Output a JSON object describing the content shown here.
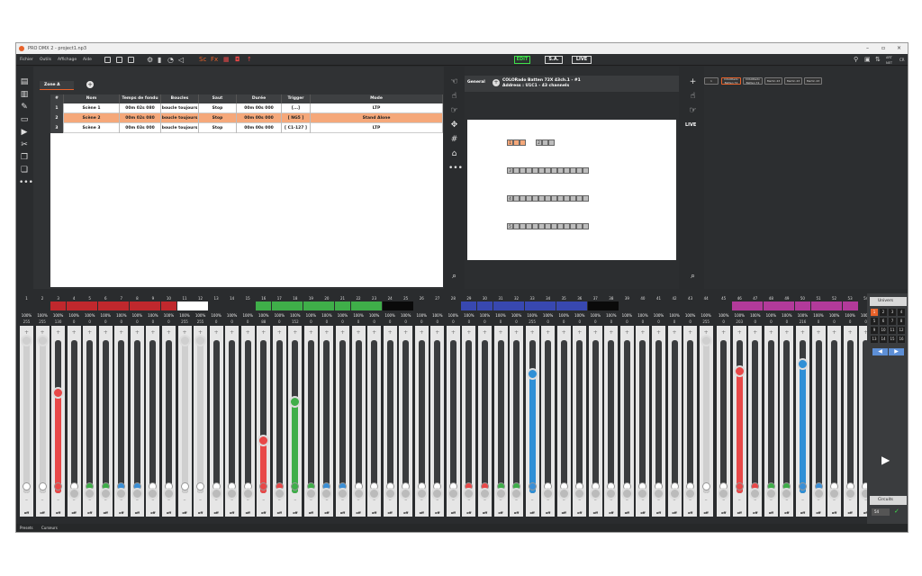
{
  "window": {
    "title": "PRO DMX 2 - project1.np3",
    "controls": [
      "–",
      "▫",
      "×"
    ]
  },
  "menu": {
    "items": [
      "Fichier",
      "Outils",
      "Affichage",
      "Aide"
    ],
    "modes": [
      "EDIT",
      "S.A.",
      "LIVE"
    ],
    "right_labels": [
      "ART NET",
      "CR"
    ]
  },
  "scenes": {
    "tab_label": "Zone A",
    "headers": [
      "#",
      "Nom",
      "Temps de fondu",
      "Boucles",
      "Saut",
      "Durée",
      "Trigger",
      "Mode"
    ],
    "rows": [
      {
        "num": "1",
        "name": "Scène 1",
        "fade": "00m 02s 080",
        "loop": "boucle toujours",
        "jump": "Stop",
        "duration": "00m 00s 000",
        "trigger": "[...]",
        "mode": "LTP",
        "selected": false
      },
      {
        "num": "2",
        "name": "Scène 2",
        "fade": "00m 02s 080",
        "loop": "boucle toujours",
        "jump": "Stop",
        "duration": "00m 00s 000",
        "trigger": "[ NG5 ]",
        "mode": "Stand Alone",
        "selected": true
      },
      {
        "num": "3",
        "name": "Scène 3",
        "fade": "00m 03s 000",
        "loop": "boucle toujours",
        "jump": "Stop",
        "duration": "00m 00s 000",
        "trigger": "[ C1-127 ]",
        "mode": "LTP",
        "selected": false
      }
    ]
  },
  "fixture": {
    "tab_label": "General",
    "name": "COLORado Batten 72X 43ch.1 - #1",
    "address": "Address : U1C1 - 43 channels",
    "group_labels": [
      "1",
      "2",
      "3",
      "4",
      "5"
    ]
  },
  "presets": {
    "chips": [
      "1",
      "COLORado Batten 72",
      "COLORado Batten 72",
      "Martin 43",
      "Martin 43",
      "Martin 43"
    ],
    "live_label": "LIVE"
  },
  "faders": {
    "channels": [
      {
        "n": "1",
        "color": "#2a2c2e",
        "val": "255",
        "level": 1.0,
        "fill": "#cfcfcf",
        "ball": "#ffffff"
      },
      {
        "n": "2",
        "color": "#2a2c2e",
        "val": "255",
        "level": 1.0,
        "fill": "#cfcfcf",
        "ball": "#ffffff"
      },
      {
        "n": "3",
        "color": "#c0282d",
        "val": "130",
        "level": 0.66,
        "fill": "#e84848",
        "ball": "#e84848"
      },
      {
        "n": "4",
        "color": "#c0282d",
        "val": "0",
        "level": 0,
        "fill": "",
        "ball": "#ffffff"
      },
      {
        "n": "5",
        "color": "#c0282d",
        "val": "0",
        "level": 0,
        "fill": "",
        "ball": "#3fae49"
      },
      {
        "n": "6",
        "color": "#c0282d",
        "val": "0",
        "level": 0,
        "fill": "",
        "ball": "#3fae49"
      },
      {
        "n": "7",
        "color": "#c0282d",
        "val": "0",
        "level": 0,
        "fill": "",
        "ball": "#3b8fd6"
      },
      {
        "n": "8",
        "color": "#c0282d",
        "val": "0",
        "level": 0,
        "fill": "",
        "ball": "#3b8fd6"
      },
      {
        "n": "9",
        "color": "#c0282d",
        "val": "0",
        "level": 0,
        "fill": "",
        "ball": "#ffffff"
      },
      {
        "n": "10",
        "color": "#c0282d",
        "val": "0",
        "level": 0,
        "fill": "",
        "ball": "#ffffff"
      },
      {
        "n": "11",
        "color": "#ffffff",
        "val": "255",
        "level": 1.0,
        "fill": "#cfcfcf",
        "ball": "#ffffff"
      },
      {
        "n": "12",
        "color": "#ffffff",
        "val": "255",
        "level": 1.0,
        "fill": "#cfcfcf",
        "ball": "#ffffff"
      },
      {
        "n": "13",
        "color": "#2a2c2e",
        "val": "0",
        "level": 0,
        "fill": "",
        "ball": "#ffffff"
      },
      {
        "n": "14",
        "color": "#2a2c2e",
        "val": "0",
        "level": 0,
        "fill": "",
        "ball": "#ffffff"
      },
      {
        "n": "15",
        "color": "#2a2c2e",
        "val": "0",
        "level": 0,
        "fill": "",
        "ball": "#ffffff"
      },
      {
        "n": "16",
        "color": "#3fae49",
        "val": "88",
        "level": 0.35,
        "fill": "#e84848",
        "ball": "#e84848"
      },
      {
        "n": "17",
        "color": "#3fae49",
        "val": "0",
        "level": 0,
        "fill": "",
        "ball": "#e84848"
      },
      {
        "n": "18",
        "color": "#3fae49",
        "val": "152",
        "level": 0.6,
        "fill": "#3fae49",
        "ball": "#3fae49"
      },
      {
        "n": "19",
        "color": "#3fae49",
        "val": "0",
        "level": 0,
        "fill": "",
        "ball": "#3fae49"
      },
      {
        "n": "20",
        "color": "#3fae49",
        "val": "0",
        "level": 0,
        "fill": "",
        "ball": "#3b8fd6"
      },
      {
        "n": "21",
        "color": "#3fae49",
        "val": "0",
        "level": 0,
        "fill": "",
        "ball": "#3b8fd6"
      },
      {
        "n": "22",
        "color": "#3fae49",
        "val": "0",
        "level": 0,
        "fill": "",
        "ball": "#ffffff"
      },
      {
        "n": "23",
        "color": "#3fae49",
        "val": "0",
        "level": 0,
        "fill": "",
        "ball": "#ffffff"
      },
      {
        "n": "24",
        "color": "#0a0a0a",
        "val": "0",
        "level": 0,
        "fill": "",
        "ball": "#ffffff"
      },
      {
        "n": "25",
        "color": "#0a0a0a",
        "val": "0",
        "level": 0,
        "fill": "",
        "ball": "#ffffff"
      },
      {
        "n": "26",
        "color": "#2a2c2e",
        "val": "0",
        "level": 0,
        "fill": "",
        "ball": "#ffffff"
      },
      {
        "n": "27",
        "color": "#2a2c2e",
        "val": "0",
        "level": 0,
        "fill": "",
        "ball": "#ffffff"
      },
      {
        "n": "28",
        "color": "#2a2c2e",
        "val": "0",
        "level": 0,
        "fill": "",
        "ball": "#ffffff"
      },
      {
        "n": "29",
        "color": "#3848b0",
        "val": "0",
        "level": 0,
        "fill": "",
        "ball": "#e84848"
      },
      {
        "n": "30",
        "color": "#3848b0",
        "val": "0",
        "level": 0,
        "fill": "",
        "ball": "#e84848"
      },
      {
        "n": "31",
        "color": "#3848b0",
        "val": "0",
        "level": 0,
        "fill": "",
        "ball": "#3fae49"
      },
      {
        "n": "32",
        "color": "#3848b0",
        "val": "0",
        "level": 0,
        "fill": "",
        "ball": "#3fae49"
      },
      {
        "n": "33",
        "color": "#3848b0",
        "val": "255",
        "level": 0.78,
        "fill": "#2f8fd6",
        "ball": "#3b8fd6"
      },
      {
        "n": "34",
        "color": "#3848b0",
        "val": "0",
        "level": 0,
        "fill": "",
        "ball": "#ffffff"
      },
      {
        "n": "35",
        "color": "#3848b0",
        "val": "0",
        "level": 0,
        "fill": "",
        "ball": "#ffffff"
      },
      {
        "n": "36",
        "color": "#3848b0",
        "val": "0",
        "level": 0,
        "fill": "",
        "ball": "#ffffff"
      },
      {
        "n": "37",
        "color": "#0a0a0a",
        "val": "0",
        "level": 0,
        "fill": "",
        "ball": "#ffffff"
      },
      {
        "n": "38",
        "color": "#0a0a0a",
        "val": "0",
        "level": 0,
        "fill": "",
        "ball": "#ffffff"
      },
      {
        "n": "39",
        "color": "#2a2c2e",
        "val": "0",
        "level": 0,
        "fill": "",
        "ball": "#ffffff"
      },
      {
        "n": "40",
        "color": "#2a2c2e",
        "val": "0",
        "level": 0,
        "fill": "",
        "ball": "#ffffff"
      },
      {
        "n": "41",
        "color": "#2a2c2e",
        "val": "0",
        "level": 0,
        "fill": "",
        "ball": "#ffffff"
      },
      {
        "n": "42",
        "color": "#2a2c2e",
        "val": "0",
        "level": 0,
        "fill": "",
        "ball": "#ffffff"
      },
      {
        "n": "43",
        "color": "#2a2c2e",
        "val": "0",
        "level": 0,
        "fill": "",
        "ball": "#ffffff"
      },
      {
        "n": "44",
        "color": "#2a2c2e",
        "val": "255",
        "level": 1.0,
        "fill": "#cfcfcf",
        "ball": "#ffffff"
      },
      {
        "n": "45",
        "color": "#2a2c2e",
        "val": "0",
        "level": 0,
        "fill": "",
        "ball": "#ffffff"
      },
      {
        "n": "46",
        "color": "#b23a9a",
        "val": "203",
        "level": 0.8,
        "fill": "#e84848",
        "ball": "#e84848"
      },
      {
        "n": "47",
        "color": "#b23a9a",
        "val": "0",
        "level": 0,
        "fill": "",
        "ball": "#e84848"
      },
      {
        "n": "48",
        "color": "#b23a9a",
        "val": "0",
        "level": 0,
        "fill": "",
        "ball": "#3fae49"
      },
      {
        "n": "49",
        "color": "#b23a9a",
        "val": "0",
        "level": 0,
        "fill": "",
        "ball": "#3fae49"
      },
      {
        "n": "50",
        "color": "#b23a9a",
        "val": "216",
        "level": 0.85,
        "fill": "#2f8fd6",
        "ball": "#3b8fd6"
      },
      {
        "n": "51",
        "color": "#b23a9a",
        "val": "0",
        "level": 0,
        "fill": "",
        "ball": "#3b8fd6"
      },
      {
        "n": "52",
        "color": "#b23a9a",
        "val": "0",
        "level": 0,
        "fill": "",
        "ball": "#ffffff"
      },
      {
        "n": "53",
        "color": "#b23a9a",
        "val": "0",
        "level": 0,
        "fill": "",
        "ball": "#ffffff"
      },
      {
        "n": "54",
        "color": "#2a2c2e",
        "val": "0",
        "level": 0,
        "fill": "",
        "ball": "#ffffff"
      }
    ],
    "percent": "100%",
    "off": "off"
  },
  "right_panel": {
    "title": "Univers",
    "numbers": [
      "1",
      "2",
      "3",
      "4",
      "5",
      "6",
      "7",
      "8",
      "9",
      "10",
      "11",
      "12",
      "13",
      "14",
      "15",
      "16"
    ],
    "circuits": "Circuits",
    "input_value": "54"
  },
  "bottom_tabs": [
    "Presets",
    "Curseurs"
  ]
}
